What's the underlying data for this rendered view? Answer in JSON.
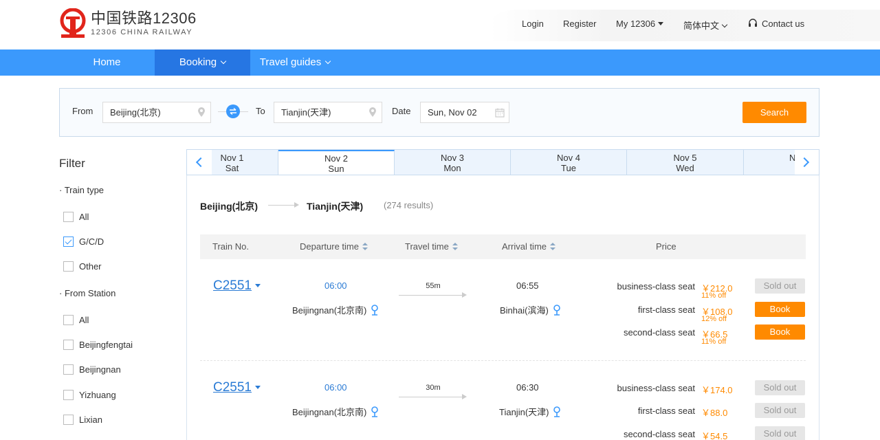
{
  "logo": {
    "cn": "中国铁路12306",
    "en": "12306 CHINA RAILWAY"
  },
  "topnav": {
    "login": "Login",
    "register": "Register",
    "my": "My 12306",
    "lang": "简体中文",
    "contact": "Contact us"
  },
  "nav": {
    "home": "Home",
    "booking": "Booking",
    "guides": "Travel guides"
  },
  "search": {
    "from_label": "From",
    "from_value": "Beijing(北京)",
    "to_label": "To",
    "to_value": "Tianjin(天津)",
    "date_label": "Date",
    "date_value": "Sun, Nov 02",
    "button": "Search"
  },
  "filter": {
    "title": "Filter",
    "train_type_label": "Train type",
    "train_types": [
      {
        "label": "All",
        "checked": false
      },
      {
        "label": "G/C/D",
        "checked": true
      },
      {
        "label": "Other",
        "checked": false
      }
    ],
    "from_station_label": "From Station",
    "stations": [
      {
        "label": "All",
        "checked": false
      },
      {
        "label": "Beijingfengtai",
        "checked": false
      },
      {
        "label": "Beijingnan",
        "checked": false
      },
      {
        "label": "Yizhuang",
        "checked": false
      },
      {
        "label": "Lixian",
        "checked": false
      }
    ]
  },
  "dates": [
    {
      "date": "Nov 1",
      "day": "Sat"
    },
    {
      "date": "Nov 2",
      "day": "Sun"
    },
    {
      "date": "Nov 3",
      "day": "Mon"
    },
    {
      "date": "Nov 4",
      "day": "Tue"
    },
    {
      "date": "Nov 5",
      "day": "Wed"
    },
    {
      "date": "N",
      "day": ""
    }
  ],
  "route": {
    "from": "Beijing(北京)",
    "to": "Tianjin(天津)",
    "count": "(274 results)"
  },
  "columns": {
    "train_no": "Train No.",
    "departure": "Departure time",
    "travel": "Travel time",
    "arrival": "Arrival time",
    "price": "Price"
  },
  "trains": [
    {
      "no": "C2551",
      "dep_time": "06:00",
      "duration": "55m",
      "arr_time": "06:55",
      "dep_station": "Beijingnan(北京南)",
      "arr_station": "Binhai(滨海)",
      "seats": [
        {
          "type": "business-class seat",
          "price": "￥212.0",
          "discount": "11% off",
          "action": "Sold out"
        },
        {
          "type": "first-class seat",
          "price": "￥108.0",
          "discount": "12% off",
          "action": "Book"
        },
        {
          "type": "second-class seat",
          "price": "￥66.5",
          "discount": "11% off",
          "action": "Book"
        }
      ]
    },
    {
      "no": "C2551",
      "dep_time": "06:00",
      "duration": "30m",
      "arr_time": "06:30",
      "dep_station": "Beijingnan(北京南)",
      "arr_station": "Tianjin(天津)",
      "seats": [
        {
          "type": "business-class seat",
          "price": "￥174.0",
          "discount": "",
          "action": "Sold out"
        },
        {
          "type": "first-class seat",
          "price": "￥88.0",
          "discount": "",
          "action": "Sold out"
        },
        {
          "type": "second-class seat",
          "price": "￥54.5",
          "discount": "",
          "action": "Sold out"
        }
      ]
    }
  ],
  "colors": {
    "accent": "#3b99fc",
    "accent_dark": "#2676e3",
    "orange": "#ff8a00",
    "link": "#2a7bd5"
  }
}
